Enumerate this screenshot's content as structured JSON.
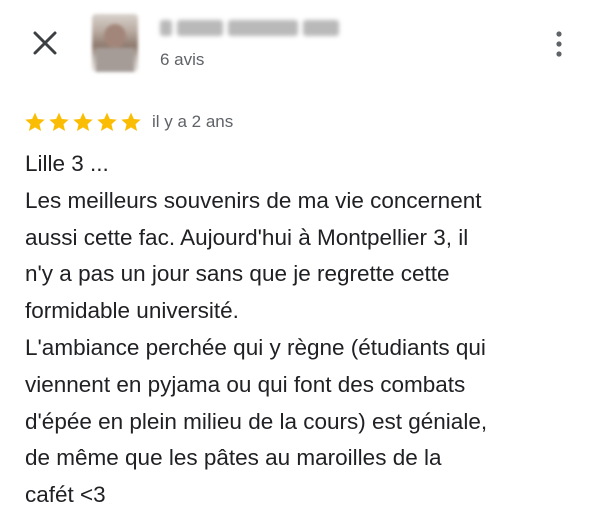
{
  "header": {
    "close_icon": "close-icon",
    "more_icon": "more-vert-icon",
    "reviewer_count_label": "6 avis"
  },
  "rating": {
    "stars": 5,
    "max_stars": 5,
    "star_color": "#FBBC04",
    "date": "il y a 2 ans"
  },
  "review": {
    "lines": [
      "Lille 3 ...",
      "Les meilleurs souvenirs de ma vie concernent",
      "aussi cette fac. Aujourd'hui à Montpellier 3, il",
      "n'y a pas un jour sans que je regrette cette",
      "formidable université.",
      "L'ambiance perchée qui y règne (étudiants qui",
      "viennent en pyjama ou qui font des combats",
      "d'épée en plein milieu de la cours) est géniale,",
      "de même que les pâtes au maroilles de la",
      "cafét <3"
    ]
  },
  "colors": {
    "text_primary": "#202124",
    "text_secondary": "#5f6368",
    "star": "#FBBC04"
  }
}
